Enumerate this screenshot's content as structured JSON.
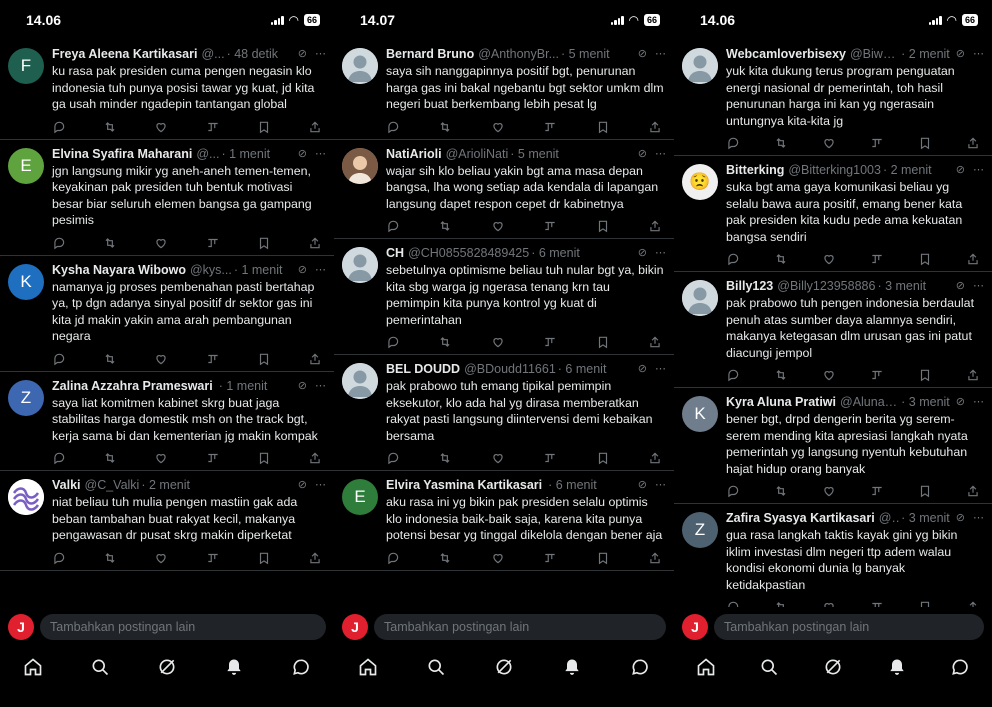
{
  "screens": [
    {
      "status": {
        "time": "14.06",
        "battery": "66"
      },
      "tweets": [
        {
          "avatar_letter": "F",
          "avatar_color": "#1f5f4f",
          "name": "Freya Aleena Kartikasari",
          "handle": "@...",
          "time": "· 48 detik",
          "text": "ku rasa pak presiden cuma pengen negasin klo indonesia tuh punya posisi tawar yg kuat, jd kita ga usah minder ngadepin tantangan global"
        },
        {
          "avatar_letter": "E",
          "avatar_color": "#5fa33e",
          "name": "Elvina Syafira Maharani",
          "handle": "@...",
          "time": "· 1 menit",
          "text": "jgn langsung mikir yg aneh-aneh temen-temen, keyakinan pak presiden tuh bentuk motivasi besar biar seluruh elemen bangsa ga gampang pesimis"
        },
        {
          "avatar_letter": "K",
          "avatar_color": "#1e6fc0",
          "name": "Kysha Nayara Wibowo",
          "handle": "@kys...",
          "time": "· 1 menit",
          "text": "namanya jg proses pembenahan pasti bertahap ya, tp dgn adanya sinyal positif dr sektor gas ini kita jd makin yakin ama arah pembangunan negara"
        },
        {
          "avatar_letter": "Z",
          "avatar_color": "#3d67b0",
          "name": "Zalina Azzahra Prameswari",
          "handle": "",
          "time": "· 1 menit",
          "text": "saya liat komitmen kabinet skrg buat jaga stabilitas harga domestik msh on the track bgt, kerja sama bi dan kementerian jg makin kompak"
        },
        {
          "avatar_letter": "",
          "avatar_color": "#ffffff",
          "avatar_kind": "swirl",
          "name": "Valki",
          "handle": "@C_Valki",
          "time": "· 2 menit",
          "text": "niat beliau tuh mulia pengen mastiin gak ada beban tambahan buat rakyat kecil, makanya pengawasan dr pusat skrg makin diperketat"
        }
      ],
      "compose_placeholder": "Tambahkan postingan lain"
    },
    {
      "status": {
        "time": "14.07",
        "battery": "66"
      },
      "tweets": [
        {
          "avatar_letter": "",
          "avatar_color": "#cfd9de",
          "avatar_kind": "default",
          "name": "Bernard Bruno",
          "handle": "@AnthonyBr...",
          "time": "· 5 menit",
          "text": "saya sih nanggapinnya positif bgt, penurunan harga gas ini bakal ngebantu bgt sektor umkm dlm negeri buat berkembang lebih pesat lg"
        },
        {
          "avatar_letter": "",
          "avatar_color": "#c9a27e",
          "avatar_kind": "photo",
          "name": "NatiArioli",
          "handle": "@ArioliNati",
          "time": "· 5 menit",
          "text": "wajar sih klo beliau yakin bgt ama masa depan bangsa, lha wong setiap ada kendala di lapangan langsung dapet respon cepet dr kabinetnya"
        },
        {
          "avatar_letter": "",
          "avatar_color": "#cfd9de",
          "avatar_kind": "default",
          "name": "CH",
          "handle": "@CH0855828489425",
          "time": "· 6 menit",
          "text": "sebetulnya optimisme beliau tuh nular bgt ya, bikin kita sbg warga jg ngerasa tenang krn tau pemimpin kita punya kontrol yg kuat di pemerintahan"
        },
        {
          "avatar_letter": "",
          "avatar_color": "#cfd9de",
          "avatar_kind": "default",
          "name": "BEL DOUDD",
          "handle": "@BDoudd11661",
          "time": "· 6 menit",
          "text": "pak prabowo tuh emang tipikal pemimpin eksekutor, klo ada hal yg dirasa memberatkan rakyat pasti langsung diintervensi demi kebaikan bersama"
        },
        {
          "avatar_letter": "E",
          "avatar_color": "#2e7d3a",
          "name": "Elvira Yasmina Kartikasari",
          "handle": "",
          "time": "· 6 menit",
          "text": "aku rasa ini yg bikin pak presiden selalu optimis klo indonesia baik-baik saja, karena kita punya potensi besar yg tinggal dikelola dengan bener aja"
        }
      ],
      "compose_placeholder": "Tambahkan postingan lain"
    },
    {
      "status": {
        "time": "14.06",
        "battery": "66"
      },
      "tweets": [
        {
          "avatar_letter": "",
          "avatar_color": "#cfd9de",
          "avatar_kind": "default",
          "name": "Webcamloverbisexy",
          "handle": "@Biwe...",
          "time": "· 2 menit",
          "text": "yuk kita dukung terus program penguatan energi nasional dr pemerintah, toh hasil penurunan harga ini kan yg ngerasain untungnya kita-kita jg"
        },
        {
          "avatar_letter": "😟",
          "avatar_color": "#f0f0f0",
          "name": "Bitterking",
          "handle": "@Bitterking1003",
          "time": "· 2 menit",
          "text": "suka bgt ama gaya komunikasi beliau yg selalu bawa aura positif, emang bener kata pak presiden kita kudu pede ama kekuatan bangsa sendiri"
        },
        {
          "avatar_letter": "",
          "avatar_color": "#cfd9de",
          "avatar_kind": "default",
          "name": "Billy123",
          "handle": "@Billy123958886",
          "time": "· 3 menit",
          "text": "pak prabowo tuh pengen indonesia berdaulat penuh atas sumber daya alamnya sendiri, makanya ketegasan dlm urusan gas ini patut diacungi jempol"
        },
        {
          "avatar_letter": "K",
          "avatar_color": "#6f7d8c",
          "name": "Kyra Aluna Pratiwi",
          "handle": "@AlunaK...",
          "time": "· 3 menit",
          "text": "bener bgt, drpd dengerin berita yg serem-serem mending kita apresiasi langkah nyata pemerintah yg langsung nyentuh kebutuhan hajat hidup orang banyak"
        },
        {
          "avatar_letter": "Z",
          "avatar_color": "#4d6170",
          "name": "Zafira Syasya Kartikasari",
          "handle": "@...",
          "time": "· 3 menit",
          "text": "gua rasa langkah taktis kayak gini yg bikin iklim investasi dlm negeri ttp adem walau kondisi ekonomi dunia lg banyak ketidakpastian"
        }
      ],
      "compose_placeholder": "Tambahkan postingan lain"
    }
  ],
  "icons": {
    "reply": "reply-icon",
    "repost": "repost-icon",
    "like": "like-icon",
    "stats": "stats-icon",
    "bookmark": "bookmark-icon",
    "share": "share-icon",
    "grok": "grok-icon",
    "more": "more-icon",
    "nav": [
      "home-icon",
      "search-icon",
      "grok-icon",
      "notifications-icon",
      "messages-icon"
    ]
  }
}
